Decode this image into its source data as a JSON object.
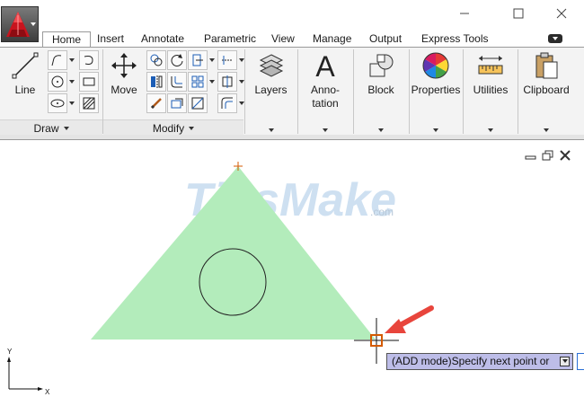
{
  "ribbon_tabs": [
    {
      "label": "Home",
      "active": true
    },
    {
      "label": "Insert"
    },
    {
      "label": "Annotate"
    },
    {
      "label": "Parametric"
    },
    {
      "label": "View"
    },
    {
      "label": "Manage"
    },
    {
      "label": "Output"
    },
    {
      "label": "Express Tools"
    }
  ],
  "panels": {
    "draw": {
      "title": "Draw",
      "line_label": "Line"
    },
    "modify": {
      "title": "Modify",
      "move_label": "Move"
    },
    "layers": {
      "label": "Layers"
    },
    "annotation": {
      "label_line1": "Anno-",
      "label_line2": "tation"
    },
    "block": {
      "label": "Block"
    },
    "properties": {
      "label": "Properties"
    },
    "utilities": {
      "label": "Utilities"
    },
    "clipboard": {
      "label": "Clipboard"
    }
  },
  "command_tooltip": {
    "text": "(ADD mode)Specify next point or"
  },
  "ucs": {
    "x_label": "X",
    "y_label": "Y"
  },
  "watermark": {
    "text": "TipsMake",
    "suffix": ".com"
  },
  "colors": {
    "triangle_fill": "#b3ecbb",
    "accent_red": "#e8453c",
    "marker_orange": "#d45a00",
    "tooltip_bg": "#bdbde8"
  }
}
